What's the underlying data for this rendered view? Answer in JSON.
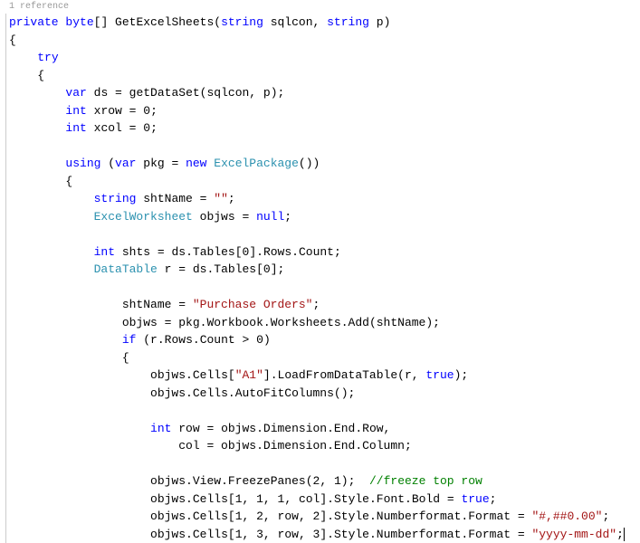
{
  "ref_hint": "1 reference",
  "code": {
    "l1_kw1": "private",
    "l1_kw2": "byte",
    "l1_method": "GetExcelSheets",
    "l1_kw3": "string",
    "l1_p1": "sqlcon",
    "l1_kw4": "string",
    "l1_p2": "p",
    "l2": "{",
    "l3_kw": "try",
    "l4": "{",
    "l5_kw": "var",
    "l5_var": "ds",
    "l5_fn": "getDataSet",
    "l5_a1": "sqlcon",
    "l5_a2": "p",
    "l6_kw": "int",
    "l6_var": "xrow",
    "l6_val": "0",
    "l7_kw": "int",
    "l7_var": "xcol",
    "l7_val": "0",
    "l9_kw1": "using",
    "l9_kw2": "var",
    "l9_var": "pkg",
    "l9_kw3": "new",
    "l9_type": "ExcelPackage",
    "l10": "{",
    "l11_kw": "string",
    "l11_var": "shtName",
    "l11_val": "\"\"",
    "l12_type": "ExcelWorksheet",
    "l12_var": "objws",
    "l12_kw": "null",
    "l14_kw": "int",
    "l14_var": "shts",
    "l14_expr1": "ds",
    "l14_expr2": "Tables",
    "l14_idx": "0",
    "l14_expr3": "Rows",
    "l14_expr4": "Count",
    "l15_type": "DataTable",
    "l15_var": "r",
    "l15_expr1": "ds",
    "l15_expr2": "Tables",
    "l15_idx": "0",
    "l17_var": "shtName",
    "l17_val": "\"Purchase Orders\"",
    "l18_var": "objws",
    "l18_e1": "pkg",
    "l18_e2": "Workbook",
    "l18_e3": "Worksheets",
    "l18_e4": "Add",
    "l18_arg": "shtName",
    "l19_kw": "if",
    "l19_e1": "r",
    "l19_e2": "Rows",
    "l19_e3": "Count",
    "l19_val": "0",
    "l20": "{",
    "l21_e1": "objws",
    "l21_e2": "Cells",
    "l21_idx": "\"A1\"",
    "l21_e3": "LoadFromDataTable",
    "l21_a1": "r",
    "l21_kw": "true",
    "l22_e1": "objws",
    "l22_e2": "Cells",
    "l22_e3": "AutoFitColumns",
    "l24_kw": "int",
    "l24_v1": "row",
    "l24_e1": "objws",
    "l24_e2": "Dimension",
    "l24_e3": "End",
    "l24_e4": "Row",
    "l25_v1": "col",
    "l25_e1": "objws",
    "l25_e2": "Dimension",
    "l25_e3": "End",
    "l25_e4": "Column",
    "l27_e1": "objws",
    "l27_e2": "View",
    "l27_e3": "FreezePanes",
    "l27_a1": "2",
    "l27_a2": "1",
    "l27_cmt": "//freeze top row",
    "l28_e1": "objws",
    "l28_e2": "Cells",
    "l28_a1": "1",
    "l28_a2": "1",
    "l28_a3": "1",
    "l28_a4": "col",
    "l28_e3": "Style",
    "l28_e4": "Font",
    "l28_e5": "Bold",
    "l28_kw": "true",
    "l29_e1": "objws",
    "l29_e2": "Cells",
    "l29_a1": "1",
    "l29_a2": "2",
    "l29_a3": "row",
    "l29_a4": "2",
    "l29_e3": "Style",
    "l29_e4": "Numberformat",
    "l29_e5": "Format",
    "l29_val": "\"#,##0.00\"",
    "l30_e1": "objws",
    "l30_e2": "Cells",
    "l30_a1": "1",
    "l30_a2": "3",
    "l30_a3": "row",
    "l30_a4": "3",
    "l30_e3": "Style",
    "l30_e4": "Numberformat",
    "l30_e5": "Format",
    "l30_val": "\"yyyy-mm-dd\""
  }
}
